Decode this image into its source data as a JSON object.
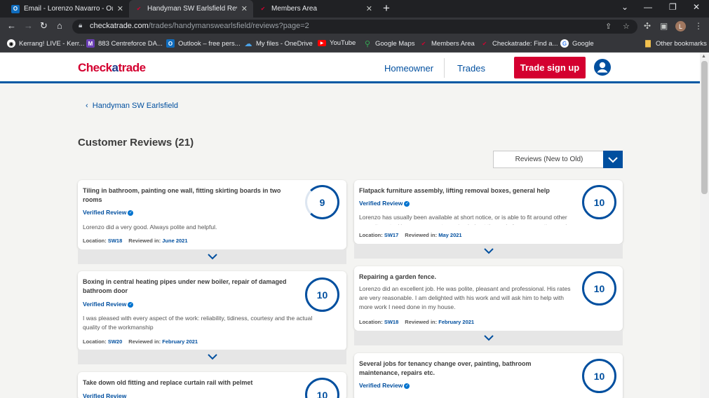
{
  "browser": {
    "tabs": [
      {
        "title": "Email - Lorenzo Navarro - Outlook",
        "icon": "outlook-icon"
      },
      {
        "title": "Handyman SW Earlsfield Reviews",
        "icon": "checkatrade-icon"
      },
      {
        "title": "Members Area",
        "icon": "checkatrade-icon"
      }
    ],
    "url_host": "checkatrade.com",
    "url_path": "/trades/handymanswearlsfield/reviews?page=2",
    "profile_initial": "L",
    "bookmarks": [
      {
        "label": "Kerrang! LIVE - Kerr...",
        "icon": "kerrang-icon",
        "color": "#ffffff"
      },
      {
        "label": "883 Centreforce DA...",
        "icon": "centreforce-icon",
        "color": "#6a3fb5"
      },
      {
        "label": "Outlook – free pers...",
        "icon": "outlook-icon",
        "color": "#0f6cbd"
      },
      {
        "label": "My files - OneDrive",
        "icon": "onedrive-icon",
        "color": "#0f6cbd"
      },
      {
        "label": "YouTube",
        "icon": "youtube-icon",
        "color": "#ff0000"
      },
      {
        "label": "Google Maps",
        "icon": "maps-icon",
        "color": "#34a853"
      },
      {
        "label": "Members Area",
        "icon": "checkatrade-icon",
        "color": "#d40030"
      },
      {
        "label": "Checkatrade: Find a...",
        "icon": "checkatrade-icon",
        "color": "#d40030"
      },
      {
        "label": "Google",
        "icon": "google-icon",
        "color": "#ffffff"
      }
    ],
    "other_bookmarks": "Other bookmarks"
  },
  "site": {
    "logo_a": "Check",
    "logo_b": "a",
    "logo_c": "trade",
    "nav": {
      "homeowner": "Homeowner",
      "trades": "Trades",
      "signup": "Trade sign up"
    },
    "brand_red": "#d40030",
    "brand_blue": "#004f9f"
  },
  "page": {
    "breadcrumb": "Handyman SW Earlsfield",
    "title": "Customer Reviews (21)",
    "sort_label": "Reviews (New to Old)"
  },
  "reviews": [
    {
      "title": "Tiling in bathroom, painting one wall, fitting skirting boards in two rooms",
      "verified": "Verified Review",
      "body": "Lorenzo did a very good. Always polite and helpful.",
      "location_label": "Location:",
      "location": "SW18",
      "reviewed_label": "Reviewed in:",
      "date": "June 2021",
      "score": "9"
    },
    {
      "title": "Boxing in central heating pipes under new boiler, repair of damaged bathroom door",
      "verified": "Verified Review",
      "body": "I was pleased with every aspect of the work: reliability, tidiness, courtesy and the actual quality of the workmanship",
      "location_label": "Location:",
      "location": "SW20",
      "reviewed_label": "Reviewed in:",
      "date": "February 2021",
      "score": "10"
    },
    {
      "title": "Take down old fitting and replace curtain rail with pelmet",
      "verified": "Verified Review",
      "score": "10"
    },
    {
      "title": "Flatpack furniture assembly, lifting removal boxes, general help",
      "verified": "Verified Review",
      "body": "Lorenzo has usually been available at short notice, or is able to fit around other commitments. He gave us great ongoing help at the end of our renovation, and",
      "location_label": "Location:",
      "location": "SW17",
      "reviewed_label": "Reviewed in:",
      "date": "May 2021",
      "score": "10"
    },
    {
      "title": "Repairing a garden fence.",
      "verified": "",
      "body": "Lorenzo did an excellent job. He was polite, pleasant and professional. His rates are very reasonable. I am delighted with his work and will ask him to help with more work I need done in my house.",
      "location_label": "Location:",
      "location": "SW18",
      "reviewed_label": "Reviewed in:",
      "date": "February 2021",
      "score": "10"
    },
    {
      "title": "Several jobs for tenancy change over, painting, bathroom maintenance, repairs etc.",
      "verified": "Verified Review",
      "score": "10"
    }
  ]
}
